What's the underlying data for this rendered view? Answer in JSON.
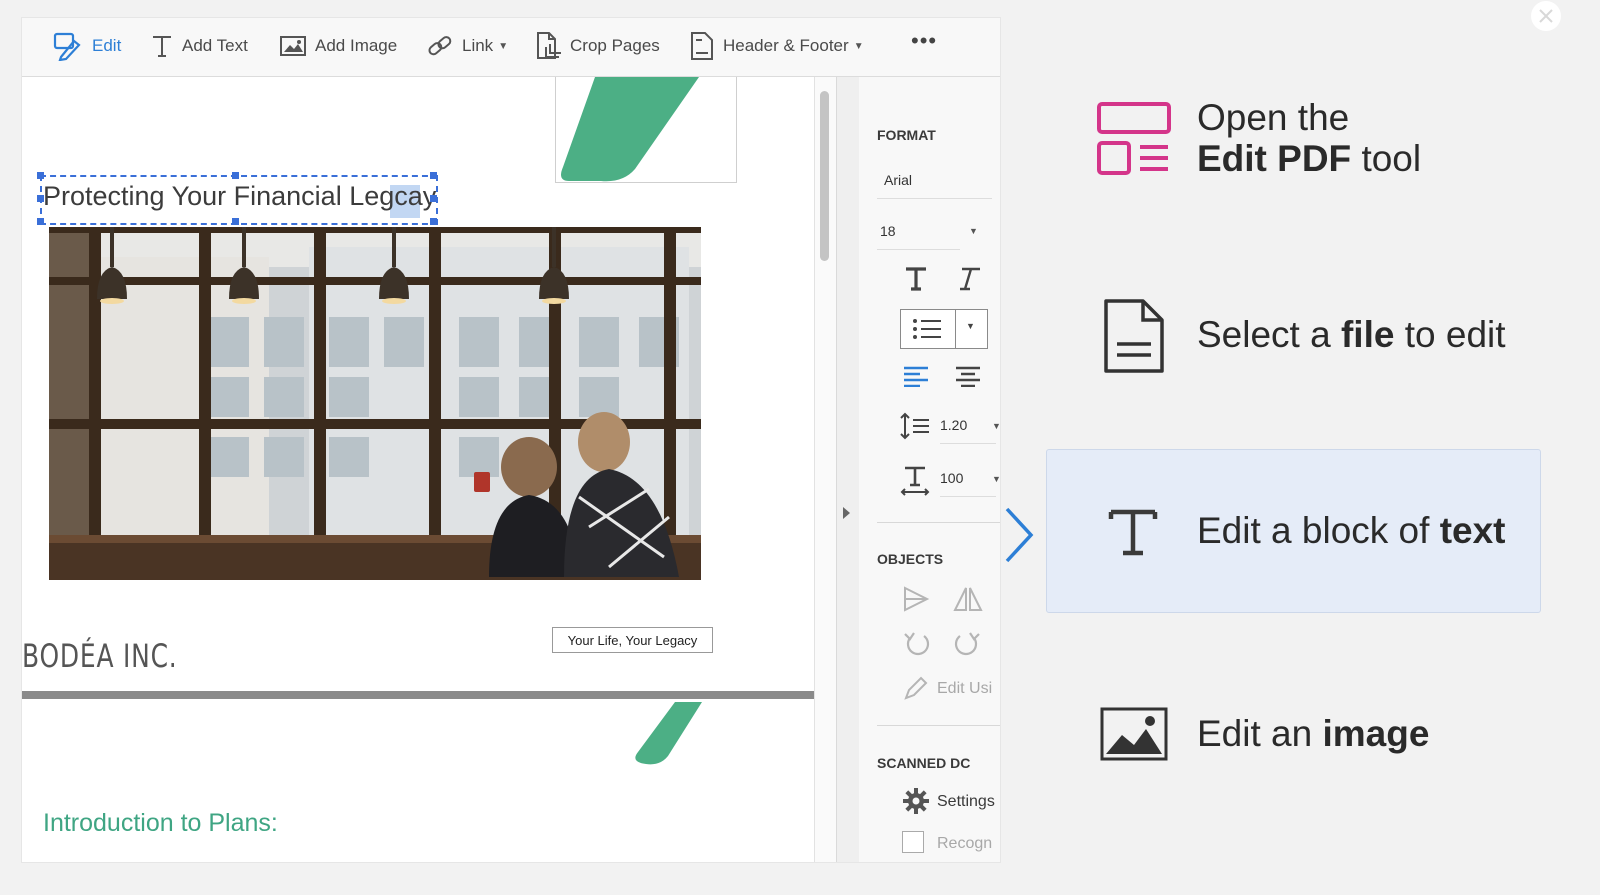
{
  "toolbar": {
    "edit": "Edit",
    "add_text": "Add Text",
    "add_image": "Add Image",
    "link": "Link",
    "crop_pages": "Crop Pages",
    "header_footer": "Header & Footer",
    "more": "•••"
  },
  "document": {
    "title": "Protecting Your Financial Legcay",
    "tagline": "Your Life, Your Legacy",
    "company": "BODÉA INC.",
    "intro_heading": "Introduction to Plans:"
  },
  "format_panel": {
    "format_heading": "FORMAT",
    "font_family": "Arial",
    "font_size": "18",
    "line_spacing": "1.20",
    "char_scale": "100",
    "objects_heading": "OBJECTS",
    "edit_using": "Edit Usi",
    "scanned_heading": "SCANNED DC",
    "settings": "Settings",
    "recognize": "Recogn"
  },
  "steps": [
    {
      "pre": "Open the",
      "bold": "Edit PDF",
      "post": " tool",
      "icon": "edit-pdf-tool-icon"
    },
    {
      "pre": "Select a ",
      "bold": "file",
      "post": " to edit",
      "icon": "file-icon"
    },
    {
      "pre": "Edit a block of ",
      "bold": "text",
      "post": "",
      "icon": "text-icon",
      "active": true
    },
    {
      "pre": "Edit an ",
      "bold": "image",
      "post": "",
      "icon": "image-icon"
    }
  ],
  "colors": {
    "accent_blue": "#2d7fd6",
    "brand_green": "#4caf85",
    "magenta": "#d4358a",
    "highlight_bg": "#e5ecf8"
  }
}
